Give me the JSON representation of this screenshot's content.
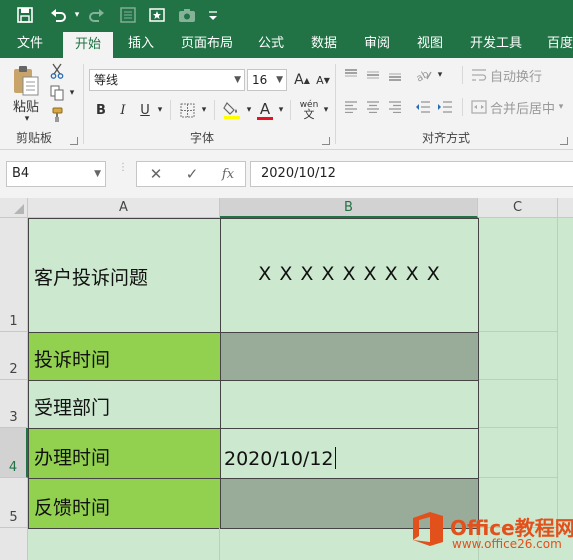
{
  "quick_access": {
    "save_icon": "save-icon",
    "undo_icon": "undo-icon",
    "redo_icon": "redo-icon",
    "customize_icon": "customize-icon"
  },
  "tabs": [
    {
      "label": "文件"
    },
    {
      "label": "开始"
    },
    {
      "label": "插入"
    },
    {
      "label": "页面布局"
    },
    {
      "label": "公式"
    },
    {
      "label": "数据"
    },
    {
      "label": "审阅"
    },
    {
      "label": "视图"
    },
    {
      "label": "开发工具"
    },
    {
      "label": "百度"
    }
  ],
  "ribbon": {
    "clipboard": {
      "paste_label": "粘贴",
      "group_label": "剪贴板"
    },
    "font": {
      "font_name": "等线",
      "font_size": "16",
      "bold": "B",
      "italic": "I",
      "underline": "U",
      "color_letter": "A",
      "phonetic": "wén",
      "grow_font": "A",
      "shrink_font": "A",
      "group_label": "字体",
      "font_color": "#e81123"
    },
    "alignment": {
      "wrap_text": "自动换行",
      "merge_center": "合并后居中",
      "group_label": "对齐方式"
    }
  },
  "formula_bar": {
    "name_box": "B4",
    "cancel": "✕",
    "enter": "✓",
    "fx": "fx",
    "formula": "2020/10/12"
  },
  "grid": {
    "columns": [
      "A",
      "B",
      "C"
    ],
    "rows": [
      "1",
      "2",
      "3",
      "4",
      "5"
    ],
    "cells": {
      "A1": "客户投诉问题",
      "B1": "X X X X X X X X X",
      "A2": "投诉时间",
      "B2": "",
      "A3": "受理部门",
      "B3": "",
      "A4": "办理时间",
      "B4": "2020/10/12",
      "A5": "反馈时间",
      "B5": ""
    }
  },
  "watermark": {
    "title": "Office教程网",
    "url": "www.office26.com"
  },
  "colors": {
    "excel_green": "#217346",
    "sheet_background": "#cce8cf",
    "label_fill": "#92d050",
    "gray_fill": "#99ab99",
    "watermark_orange": "#e2501b"
  }
}
